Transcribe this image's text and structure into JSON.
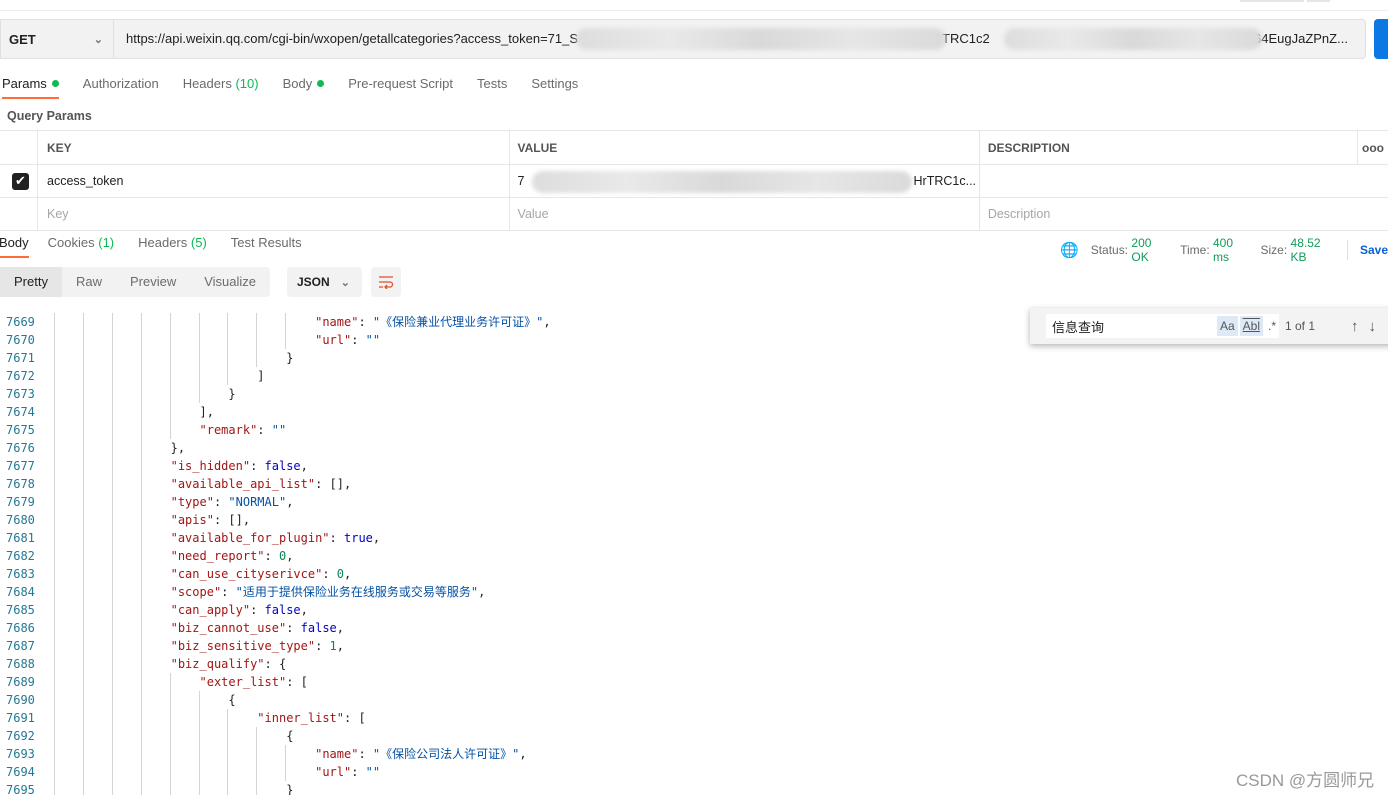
{
  "request": {
    "method": "GET",
    "url_start": "https://api.weixin.qq.com/cgi-bin/wxopen/getallcategories?access_token=71_S",
    "url_mid": "TRC1c2",
    "url_end": "64EugJaZPnZ..."
  },
  "request_tabs": [
    {
      "label": "Params",
      "dot": true,
      "active": true
    },
    {
      "label": "Authorization"
    },
    {
      "label": "Headers",
      "count": "(10)"
    },
    {
      "label": "Body",
      "dot": true
    },
    {
      "label": "Pre-request Script"
    },
    {
      "label": "Tests"
    },
    {
      "label": "Settings"
    }
  ],
  "query_params": {
    "title": "Query Params",
    "columns": [
      "KEY",
      "VALUE",
      "DESCRIPTION"
    ],
    "more": "ooo",
    "rows": [
      {
        "checked": true,
        "key": "access_token",
        "value_start": "7",
        "value_end": "HrTRC1c...",
        "description": ""
      }
    ],
    "placeholders": {
      "key": "Key",
      "value": "Value",
      "description": "Description"
    }
  },
  "response_tabs": [
    {
      "label": "Body",
      "active": true
    },
    {
      "label": "Cookies",
      "count": "(1)"
    },
    {
      "label": "Headers",
      "count": "(5)"
    },
    {
      "label": "Test Results"
    }
  ],
  "status": {
    "status_label": "Status:",
    "status_value": "200 OK",
    "time_label": "Time:",
    "time_value": "400 ms",
    "size_label": "Size:",
    "size_value": "48.52 KB",
    "save": "Save"
  },
  "view_modes": [
    "Pretty",
    "Raw",
    "Preview",
    "Visualize"
  ],
  "active_view": "Pretty",
  "format": "JSON",
  "find": {
    "query": "信息查询",
    "case": "Aa",
    "word": "Abl",
    "regex": ".*",
    "result": "1 of 1"
  },
  "code_lines": [
    {
      "n": "7669",
      "lvl": 9,
      "t": [
        [
          "k",
          "\"name\""
        ],
        [
          "p",
          ": "
        ],
        [
          "s",
          "\"《保险兼业代理业务许可证》\""
        ],
        [
          "p",
          ","
        ]
      ]
    },
    {
      "n": "7670",
      "lvl": 9,
      "t": [
        [
          "k",
          "\"url\""
        ],
        [
          "p",
          ": "
        ],
        [
          "s",
          "\"\""
        ]
      ]
    },
    {
      "n": "7671",
      "lvl": 8,
      "t": [
        [
          "p",
          "}"
        ]
      ]
    },
    {
      "n": "7672",
      "lvl": 7,
      "t": [
        [
          "p",
          "]"
        ]
      ]
    },
    {
      "n": "7673",
      "lvl": 6,
      "t": [
        [
          "p",
          "}"
        ]
      ]
    },
    {
      "n": "7674",
      "lvl": 5,
      "t": [
        [
          "p",
          "],"
        ]
      ]
    },
    {
      "n": "7675",
      "lvl": 5,
      "t": [
        [
          "k",
          "\"remark\""
        ],
        [
          "p",
          ": "
        ],
        [
          "s",
          "\"\""
        ]
      ]
    },
    {
      "n": "7676",
      "lvl": 4,
      "t": [
        [
          "p",
          "},"
        ]
      ]
    },
    {
      "n": "7677",
      "lvl": 4,
      "t": [
        [
          "k",
          "\"is_hidden\""
        ],
        [
          "p",
          ": "
        ],
        [
          "b",
          "false"
        ],
        [
          "p",
          ","
        ]
      ]
    },
    {
      "n": "7678",
      "lvl": 4,
      "t": [
        [
          "k",
          "\"available_api_list\""
        ],
        [
          "p",
          ": [],"
        ]
      ]
    },
    {
      "n": "7679",
      "lvl": 4,
      "t": [
        [
          "k",
          "\"type\""
        ],
        [
          "p",
          ": "
        ],
        [
          "s",
          "\"NORMAL\""
        ],
        [
          "p",
          ","
        ]
      ]
    },
    {
      "n": "7680",
      "lvl": 4,
      "t": [
        [
          "k",
          "\"apis\""
        ],
        [
          "p",
          ": [],"
        ]
      ]
    },
    {
      "n": "7681",
      "lvl": 4,
      "t": [
        [
          "k",
          "\"available_for_plugin\""
        ],
        [
          "p",
          ": "
        ],
        [
          "b",
          "true"
        ],
        [
          "p",
          ","
        ]
      ]
    },
    {
      "n": "7682",
      "lvl": 4,
      "t": [
        [
          "k",
          "\"need_report\""
        ],
        [
          "p",
          ": "
        ],
        [
          "n",
          "0"
        ],
        [
          "p",
          ","
        ]
      ]
    },
    {
      "n": "7683",
      "lvl": 4,
      "t": [
        [
          "k",
          "\"can_use_cityserivce\""
        ],
        [
          "p",
          ": "
        ],
        [
          "n",
          "0"
        ],
        [
          "p",
          ","
        ]
      ]
    },
    {
      "n": "7684",
      "lvl": 4,
      "t": [
        [
          "k",
          "\"scope\""
        ],
        [
          "p",
          ": "
        ],
        [
          "s",
          "\"适用于提供保险业务在线服务或交易等服务\""
        ],
        [
          "p",
          ","
        ]
      ]
    },
    {
      "n": "7685",
      "lvl": 4,
      "t": [
        [
          "k",
          "\"can_apply\""
        ],
        [
          "p",
          ": "
        ],
        [
          "b",
          "false"
        ],
        [
          "p",
          ","
        ]
      ]
    },
    {
      "n": "7686",
      "lvl": 4,
      "t": [
        [
          "k",
          "\"biz_cannot_use\""
        ],
        [
          "p",
          ": "
        ],
        [
          "b",
          "false"
        ],
        [
          "p",
          ","
        ]
      ]
    },
    {
      "n": "7687",
      "lvl": 4,
      "t": [
        [
          "k",
          "\"biz_sensitive_type\""
        ],
        [
          "p",
          ": "
        ],
        [
          "n",
          "1"
        ],
        [
          "p",
          ","
        ]
      ]
    },
    {
      "n": "7688",
      "lvl": 4,
      "t": [
        [
          "k",
          "\"biz_qualify\""
        ],
        [
          "p",
          ": {"
        ]
      ]
    },
    {
      "n": "7689",
      "lvl": 5,
      "t": [
        [
          "k",
          "\"exter_list\""
        ],
        [
          "p",
          ": ["
        ]
      ]
    },
    {
      "n": "7690",
      "lvl": 6,
      "t": [
        [
          "p",
          "{"
        ]
      ]
    },
    {
      "n": "7691",
      "lvl": 7,
      "t": [
        [
          "k",
          "\"inner_list\""
        ],
        [
          "p",
          ": ["
        ]
      ]
    },
    {
      "n": "7692",
      "lvl": 8,
      "t": [
        [
          "p",
          "{"
        ]
      ]
    },
    {
      "n": "7693",
      "lvl": 9,
      "t": [
        [
          "k",
          "\"name\""
        ],
        [
          "p",
          ": "
        ],
        [
          "s",
          "\"《保险公司法人许可证》\""
        ],
        [
          "p",
          ","
        ]
      ]
    },
    {
      "n": "7694",
      "lvl": 9,
      "t": [
        [
          "k",
          "\"url\""
        ],
        [
          "p",
          ": "
        ],
        [
          "s",
          "\"\""
        ]
      ]
    },
    {
      "n": "7695",
      "lvl": 8,
      "t": [
        [
          "p",
          "}"
        ]
      ]
    }
  ],
  "watermark": "CSDN @方圆师兄",
  "colors": {
    "accent": "#ff6c37",
    "send": "#0b78e3",
    "ok": "#0f9d58",
    "key": "#a31515",
    "string": "#0451a5",
    "number": "#098658"
  }
}
